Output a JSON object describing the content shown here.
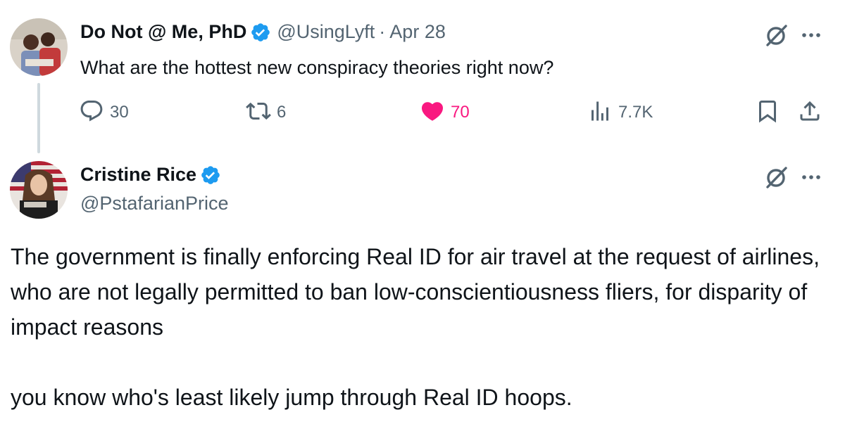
{
  "tweet1": {
    "display_name": "Do Not @ Me, PhD",
    "handle": "@UsingLyft",
    "dot": "·",
    "date": "Apr 28",
    "text": "What are the hottest new conspiracy theories right now?",
    "replies": "30",
    "retweets": "6",
    "likes": "70",
    "views": "7.7K",
    "liked": true,
    "icons": [
      "verified-badge-icon",
      "grok-icon",
      "more-icon",
      "reply-icon",
      "retweet-icon",
      "heart-icon",
      "views-icon",
      "bookmark-icon",
      "share-icon"
    ]
  },
  "tweet2": {
    "display_name": "Cristine Rice",
    "handle": "@PstafarianPrice",
    "paragraphs": [
      "The government is finally enforcing Real ID for air travel at the request of airlines, who are not legally permitted to ban low-conscientiousness fliers, for disparity of impact reasons",
      "you know who's least likely jump through Real ID hoops."
    ],
    "icons": [
      "verified-badge-icon",
      "grok-icon",
      "more-icon"
    ]
  },
  "colors": {
    "verified": "#1d9bf0",
    "like": "#f91880",
    "secondary_text": "#536471",
    "thread_line": "#cfd9de"
  }
}
